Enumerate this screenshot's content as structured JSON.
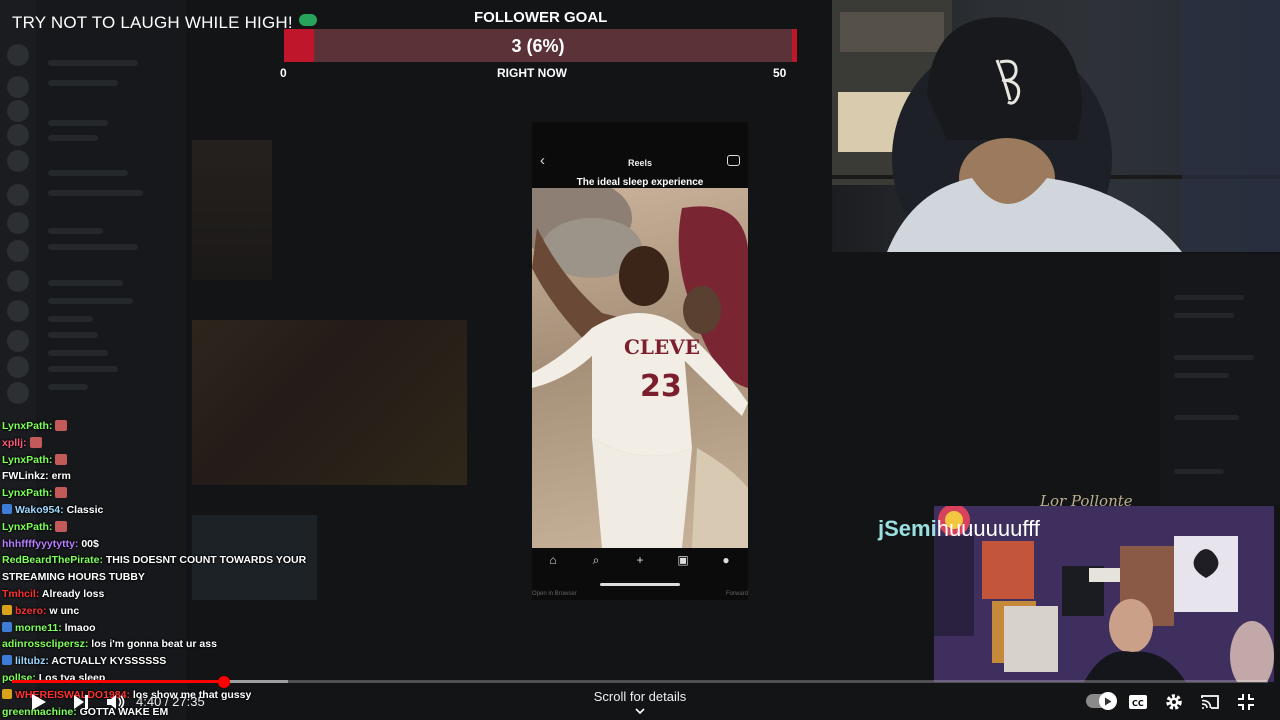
{
  "overlay": {
    "title": "TRY NOT TO LAUGH WHILE HIGH!",
    "goal": {
      "label": "FOLLOWER GOAL",
      "value_text": "3 (6%)",
      "min": "0",
      "max": "50",
      "now_label": "RIGHT NOW",
      "progress_fraction": 0.06
    }
  },
  "reel": {
    "header_title": "Reels",
    "caption": "The ideal sleep experience",
    "jersey_text": "CLEVE",
    "jersey_number": "23",
    "footer_left": "Open in Browser",
    "footer_right": "Forward"
  },
  "webcam_inset": {
    "signature": "Lor Pollonte",
    "chat_user": "jSemi",
    "chat_message": "huuuuuufff"
  },
  "chat": [
    {
      "user": "LynxPath:",
      "message": "",
      "color": "#7fff5a",
      "emote": true
    },
    {
      "user": "xpllj:",
      "message": "",
      "color": "#ff5a7a",
      "emote": true
    },
    {
      "user": "LynxPath:",
      "message": "",
      "color": "#7fff5a",
      "emote": true
    },
    {
      "user": "FWLinkz:",
      "message": "erm",
      "color": "#ffffff"
    },
    {
      "user": "LynxPath:",
      "message": "",
      "color": "#7fff5a",
      "emote": true
    },
    {
      "user": "Wako954:",
      "message": "Classic",
      "color": "#9fd7ff",
      "badge": "#3d7dd8"
    },
    {
      "user": "LynxPath:",
      "message": "",
      "color": "#7fff5a",
      "emote": true
    },
    {
      "user": "hhhffffyyytytty:",
      "message": "00$",
      "color": "#b77cff"
    },
    {
      "user": "RedBeardThePirate:",
      "message": "THIS DOESNT COUNT TOWARDS YOUR STREAMING HOURS TUBBY",
      "color": "#7fff5a",
      "wrap": true
    },
    {
      "user": "Tmhcil:",
      "message": "Already loss",
      "color": "#ff3030"
    },
    {
      "user": "bzero:",
      "message": "w unc",
      "color": "#ff3030",
      "badge": "#d8a21b"
    },
    {
      "user": "morne11:",
      "message": "lmaoo",
      "color": "#7fff5a",
      "badge": "#3d7dd8"
    },
    {
      "user": "adinrossclipersz:",
      "message": "los i'm gonna beat ur ass",
      "color": "#7fff5a"
    },
    {
      "user": "liltubz:",
      "message": "ACTUALLY KYSSSSSS",
      "color": "#9fd7ff",
      "badge": "#3d7dd8"
    },
    {
      "user": "pollse:",
      "message": "Los tya sleep",
      "color": "#7fff5a"
    },
    {
      "user": "WHEREISWALDO1984:",
      "message": "los show me that gussy",
      "color": "#ff3030",
      "badge": "#d8a21b"
    },
    {
      "user": "greenmachine:",
      "message": "GOTTA WAKE EM",
      "color": "#7fff5a"
    }
  ],
  "player": {
    "time": "4:40 / 27:35",
    "scroll_hint": "Scroll for details",
    "progress_fraction": 0.169,
    "buffer_fraction": 0.22
  },
  "colors": {
    "goal_red": "#c0162b",
    "progress_red": "#ff0000"
  },
  "icons": {
    "play": "play-icon",
    "next": "next-icon",
    "volume": "volume-icon",
    "captions": "captions-icon",
    "settings": "gear-icon",
    "cast": "cast-icon",
    "exit_fullscreen": "exit-fullscreen-icon"
  }
}
